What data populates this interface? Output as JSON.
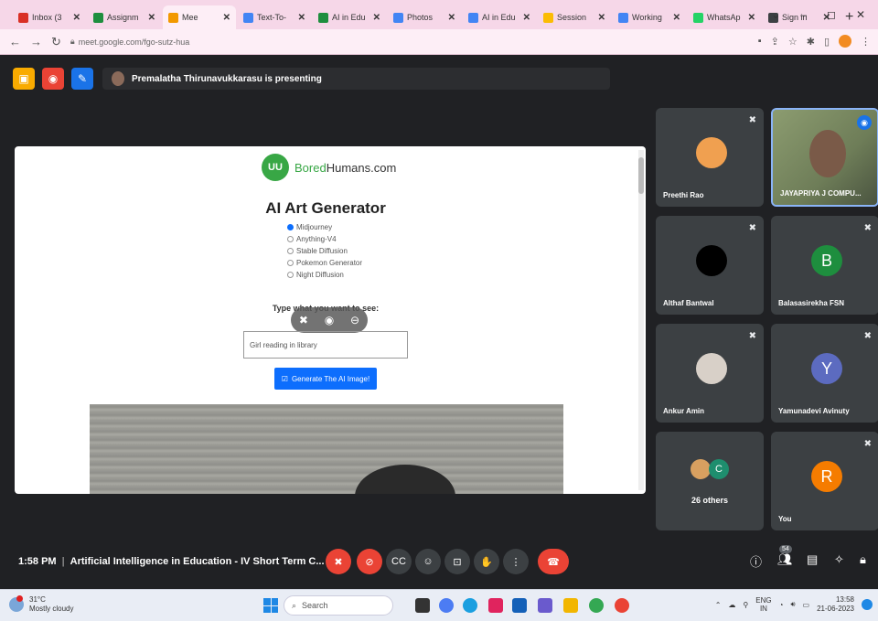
{
  "browser": {
    "tabs": [
      {
        "label": "Inbox (3",
        "color": "#d93025",
        "active": false
      },
      {
        "label": "Assignm",
        "color": "#1e8e3e",
        "active": false
      },
      {
        "label": "Mee",
        "color": "#f29900",
        "active": true
      },
      {
        "label": "Text-To-",
        "color": "#4285f4",
        "active": false
      },
      {
        "label": "AI in Edu",
        "color": "#1e8e3e",
        "active": false
      },
      {
        "label": "Photos",
        "color": "#4285f4",
        "active": false
      },
      {
        "label": "AI in Edu",
        "color": "#4285f4",
        "active": false
      },
      {
        "label": "Session",
        "color": "#fbbc04",
        "active": false
      },
      {
        "label": "Working",
        "color": "#4285f4",
        "active": false
      },
      {
        "label": "WhatsAp",
        "color": "#25d366",
        "active": false
      },
      {
        "label": "Sign in",
        "color": "#3c4043",
        "active": false
      }
    ],
    "new_tab": "+",
    "url": "meet.google.com/fgo-sutz-hua"
  },
  "meet": {
    "presenting_text": "Premalatha Thirunavukkarasu is presenting",
    "meeting_time": "1:58 PM",
    "meeting_title": "Artificial Intelligence in Education - IV Short Term C...",
    "people_count": "54"
  },
  "shared_screen": {
    "logo_text_brand": "Bored",
    "logo_text_rest": "Humans.com",
    "logo_mark": "UU",
    "title": "AI Art Generator",
    "models": [
      {
        "label": "Midjourney",
        "selected": true
      },
      {
        "label": "Anything-V4",
        "selected": false
      },
      {
        "label": "Stable Diffusion",
        "selected": false
      },
      {
        "label": "Pokemon Generator",
        "selected": false
      },
      {
        "label": "Night Diffusion",
        "selected": false
      }
    ],
    "type_label": "Type what you want to see:",
    "prompt_value": "Girl reading in library",
    "generate_label": "Generate The AI Image!"
  },
  "participants": [
    {
      "name": "Preethi Rao",
      "initial": "",
      "avatar_color": "#f0a050"
    },
    {
      "name": "JAYAPRIYA J COMPU...",
      "initial": "",
      "avatar_color": ""
    },
    {
      "name": "Althaf Bantwal",
      "initial": "",
      "avatar_color": "#000000"
    },
    {
      "name": "Balasasirekha FSN",
      "initial": "B",
      "avatar_color": "#1e8e3e"
    },
    {
      "name": "Ankur Amin",
      "initial": "",
      "avatar_color": "#d8d0c8"
    },
    {
      "name": "Yamunadevi Avinuty",
      "initial": "Y",
      "avatar_color": "#5c6bc0"
    },
    {
      "name": "You",
      "initial": "R",
      "avatar_color": "#f57c00"
    }
  ],
  "others": {
    "label": "26 others",
    "initial": "C"
  },
  "taskbar": {
    "weather_temp": "31°C",
    "weather_desc": "Mostly cloudy",
    "search_placeholder": "Search",
    "lang": "ENG",
    "lang2": "IN",
    "time": "13:58",
    "date": "21-06-2023"
  }
}
